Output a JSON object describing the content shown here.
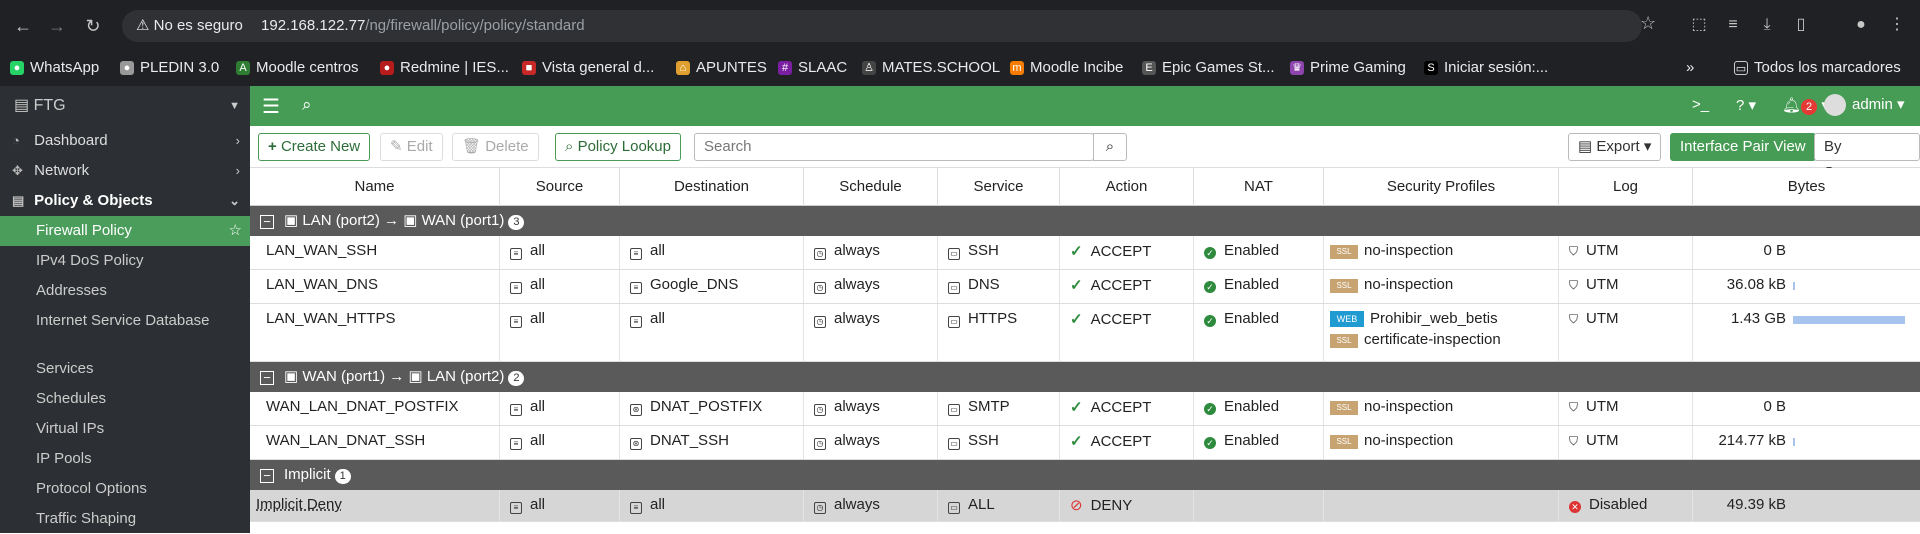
{
  "browser": {
    "not_secure": "No es seguro",
    "host": "192.168.122.77",
    "path": "/ng/firewall/policy/policy/standard",
    "bookmarks": [
      "WhatsApp",
      "PLEDIN 3.0",
      "Moodle centros",
      "Redmine | IES...",
      "Vista general d...",
      "APUNTES",
      "SLAAC",
      "MATES.SCHOOL",
      "Moodle Incibe",
      "Epic Games St...",
      "Prime Gaming",
      "Iniciar sesión:..."
    ],
    "all_bookmarks": "Todos los marcadores"
  },
  "sidebar": {
    "device": "FTG",
    "items": [
      {
        "label": "Dashboard",
        "icon": "dashboard-icon"
      },
      {
        "label": "Network",
        "icon": "network-icon"
      },
      {
        "label": "Policy & Objects",
        "icon": "policy-icon"
      }
    ],
    "sub": [
      "Firewall Policy",
      "IPv4 DoS Policy",
      "Addresses",
      "Internet Service Database",
      "Services",
      "Schedules",
      "Virtual IPs",
      "IP Pools",
      "Protocol Options",
      "Traffic Shaping"
    ]
  },
  "topbar": {
    "notifications": "2",
    "user": "admin"
  },
  "toolbar": {
    "create": "Create New",
    "edit": "Edit",
    "delete": "Delete",
    "lookup": "Policy Lookup",
    "search_placeholder": "Search",
    "export": "Export",
    "pair_view": "Interface Pair View",
    "by_sequence": "By Sequence"
  },
  "columns": [
    "Name",
    "Source",
    "Destination",
    "Schedule",
    "Service",
    "Action",
    "NAT",
    "Security Profiles",
    "Log",
    "Bytes"
  ],
  "groups": [
    {
      "from": "LAN (port2)",
      "to": "WAN (port1)",
      "count": "3"
    },
    {
      "from": "WAN (port1)",
      "to": "LAN (port2)",
      "count": "2"
    },
    {
      "label": "Implicit",
      "count": "1"
    }
  ],
  "rows": [
    {
      "name": "LAN_WAN_SSH",
      "src": "all",
      "dst": "all",
      "sched": "always",
      "svc": "SSH",
      "action": "ACCEPT",
      "nat": "Enabled",
      "prof1_tag": "SSL",
      "prof1": "no-inspection",
      "log": "UTM",
      "bytes": "0 B",
      "fill": 0
    },
    {
      "name": "LAN_WAN_DNS",
      "src": "all",
      "dst": "Google_DNS",
      "sched": "always",
      "svc": "DNS",
      "action": "ACCEPT",
      "nat": "Enabled",
      "prof1_tag": "SSL",
      "prof1": "no-inspection",
      "log": "UTM",
      "bytes": "36.08 kB",
      "fill": 0.01
    },
    {
      "name": "LAN_WAN_HTTPS",
      "src": "all",
      "dst": "all",
      "sched": "always",
      "svc": "HTTPS",
      "action": "ACCEPT",
      "nat": "Enabled",
      "prof1_tag": "WEB",
      "prof1": "Prohibir_web_betis",
      "prof2_tag": "SSL",
      "prof2": "certificate-inspection",
      "log": "UTM",
      "bytes": "1.43 GB",
      "fill": 1
    },
    {
      "name": "WAN_LAN_DNAT_POSTFIX",
      "src": "all",
      "dst": "DNAT_POSTFIX",
      "sched": "always",
      "svc": "SMTP",
      "action": "ACCEPT",
      "nat": "Enabled",
      "prof1_tag": "SSL",
      "prof1": "no-inspection",
      "log": "UTM",
      "bytes": "0 B",
      "fill": 0
    },
    {
      "name": "WAN_LAN_DNAT_SSH",
      "src": "all",
      "dst": "DNAT_SSH",
      "sched": "always",
      "svc": "SSH",
      "action": "ACCEPT",
      "nat": "Enabled",
      "prof1_tag": "SSL",
      "prof1": "no-inspection",
      "log": "UTM",
      "bytes": "214.77 kB",
      "fill": 0.01
    },
    {
      "name": "Implicit Deny",
      "src": "all",
      "dst": "all",
      "sched": "always",
      "svc": "ALL",
      "action": "DENY",
      "nat": "",
      "log": "Disabled",
      "bytes": "49.39 kB",
      "fill": 0
    }
  ]
}
